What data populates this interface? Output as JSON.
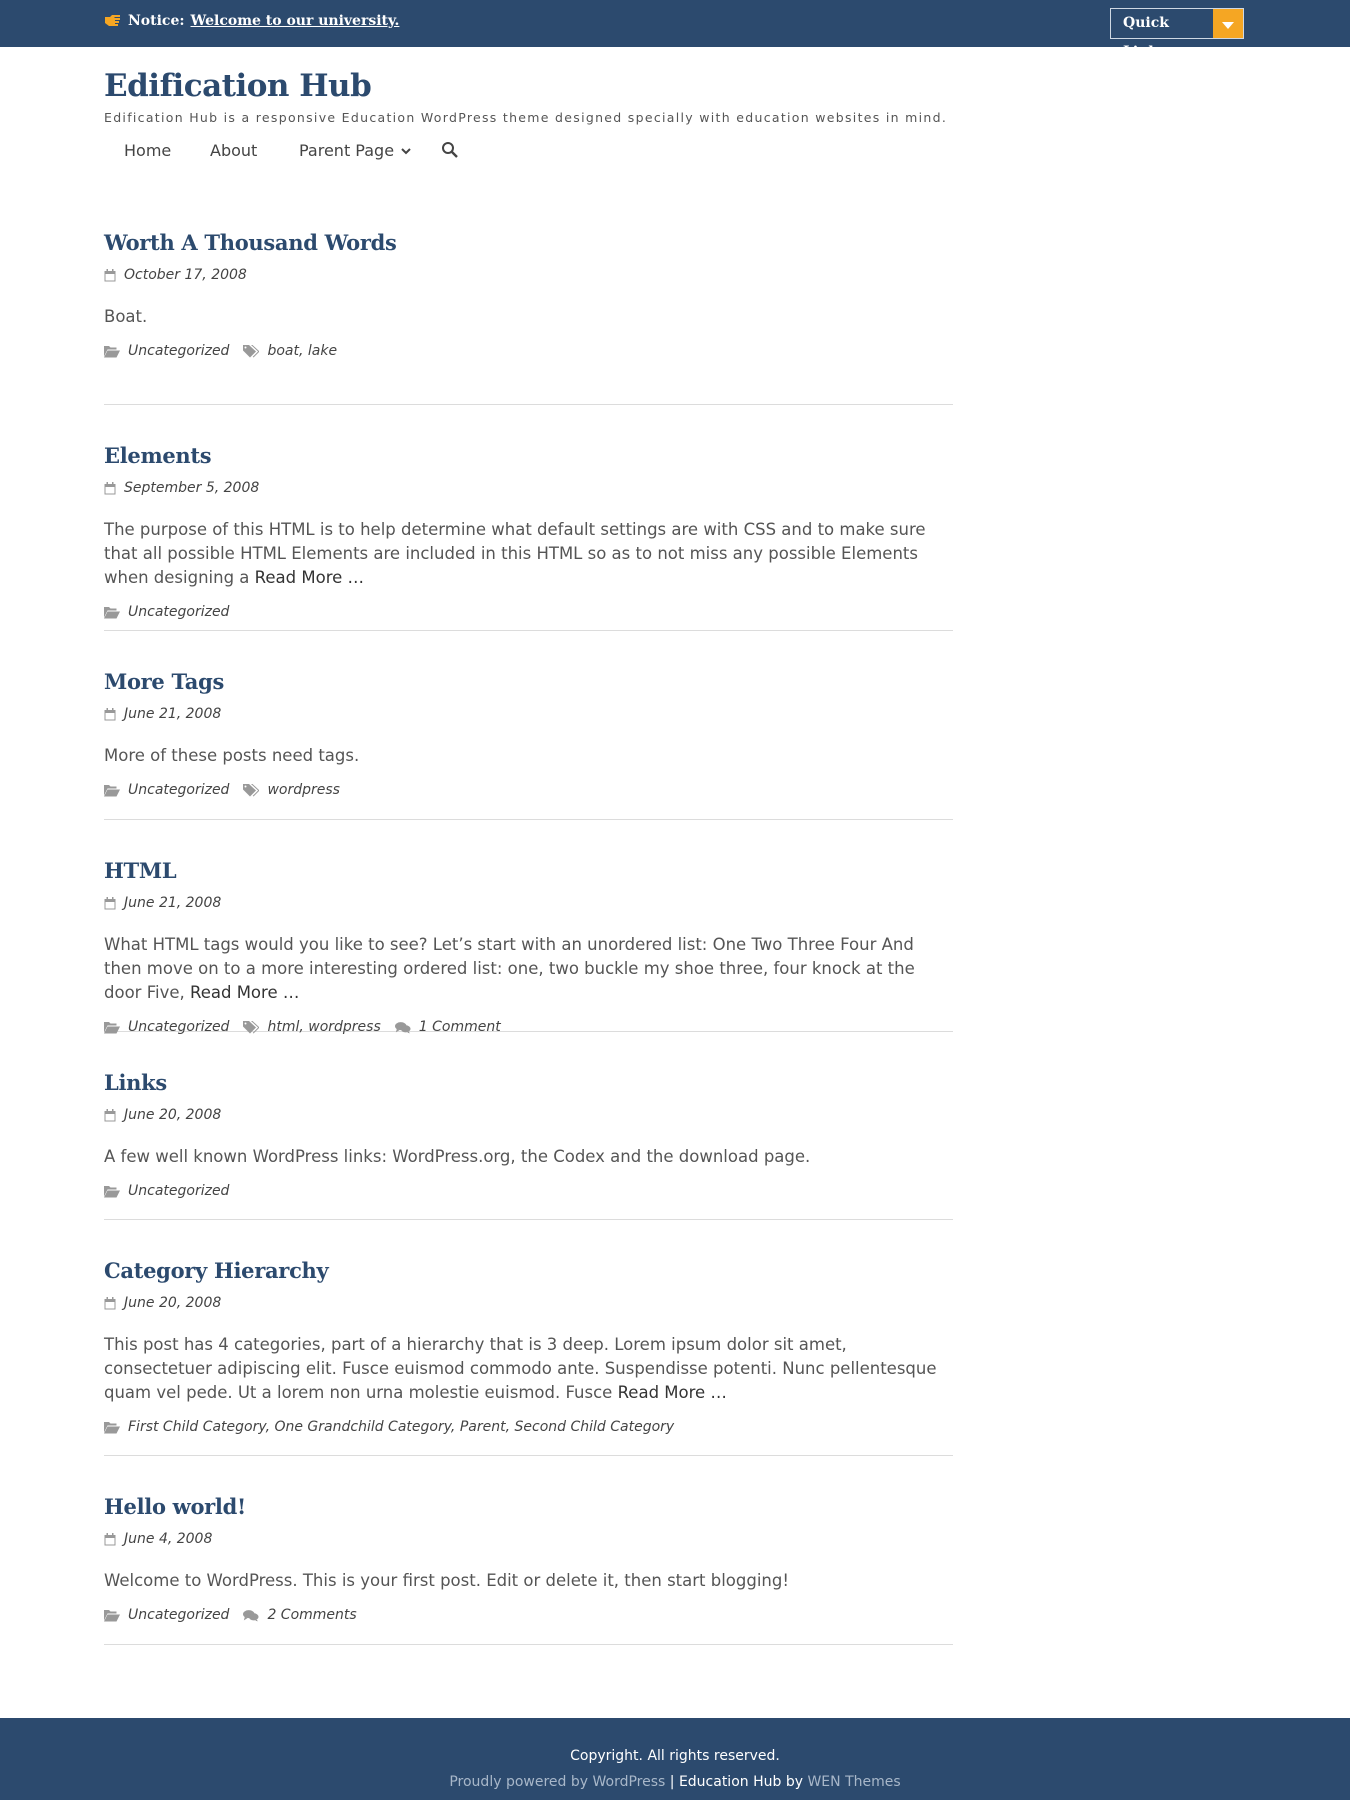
{
  "topbar": {
    "notice_label": "Notice:",
    "notice_link": "Welcome to our university.",
    "quick_links": "Quick Links",
    "accent": "#f5a623",
    "background": "#2c4a6e"
  },
  "header": {
    "site_title": "Edification Hub",
    "site_description": "Edification Hub is a responsive Education WordPress theme designed specially with education websites in mind."
  },
  "nav": {
    "home": "Home",
    "about": "About",
    "parent_page": "Parent Page"
  },
  "posts": [
    {
      "title": "Worth A Thousand Words",
      "date": "October 17, 2008",
      "excerpt": "Boat.",
      "read_more": "",
      "categories": [
        "Uncategorized"
      ],
      "tags": [
        "boat",
        "lake"
      ],
      "comments": ""
    },
    {
      "title": "Elements",
      "date": "September 5, 2008",
      "excerpt": "The purpose of this HTML is to help determine what default settings are with CSS and to make sure that all possible HTML Elements are included in this HTML so as to not miss any possible Elements when designing a",
      "read_more": "Read More",
      "categories": [
        "Uncategorized"
      ],
      "tags": [],
      "comments": ""
    },
    {
      "title": "More Tags",
      "date": "June 21, 2008",
      "excerpt": "More of these posts need tags.",
      "read_more": "",
      "categories": [
        "Uncategorized"
      ],
      "tags": [
        "wordpress"
      ],
      "comments": ""
    },
    {
      "title": "HTML",
      "date": "June 21, 2008",
      "excerpt": "What HTML tags would you like to see? Let’s start with an unordered list: One Two Three Four And then move on to a more interesting ordered list: one, two buckle my shoe three, four knock at the door Five,",
      "read_more": "Read More",
      "categories": [
        "Uncategorized"
      ],
      "tags": [
        "html",
        "wordpress"
      ],
      "comments": "1 Comment"
    },
    {
      "title": "Links",
      "date": "June 20, 2008",
      "excerpt": "A few well known WordPress links: WordPress.org, the Codex and the download page.",
      "read_more": "",
      "categories": [
        "Uncategorized"
      ],
      "tags": [],
      "comments": ""
    },
    {
      "title": "Category Hierarchy",
      "date": "June 20, 2008",
      "excerpt": "This post has 4 categories, part of a hierarchy that is 3 deep. Lorem ipsum dolor sit amet, consectetuer adipiscing elit. Fusce euismod commodo ante. Suspendisse potenti. Nunc pellentesque quam vel pede. Ut a lorem non urna molestie euismod. Fusce",
      "read_more": "Read More",
      "categories": [
        "First Child Category",
        "One Grandchild Category",
        "Parent",
        "Second Child Category"
      ],
      "tags": [],
      "comments": ""
    },
    {
      "title": "Hello world!",
      "date": "June 4, 2008",
      "excerpt": "Welcome to WordPress. This is your first post. Edit or delete it, then start blogging!",
      "read_more": "",
      "categories": [
        "Uncategorized"
      ],
      "tags": [],
      "comments": "2 Comments"
    }
  ],
  "footer": {
    "copyright": "Copyright. All rights reserved.",
    "powered_by": "Proudly powered by WordPress",
    "separator": "|",
    "theme_text": "Education Hub by",
    "theme_author": "WEN Themes"
  }
}
